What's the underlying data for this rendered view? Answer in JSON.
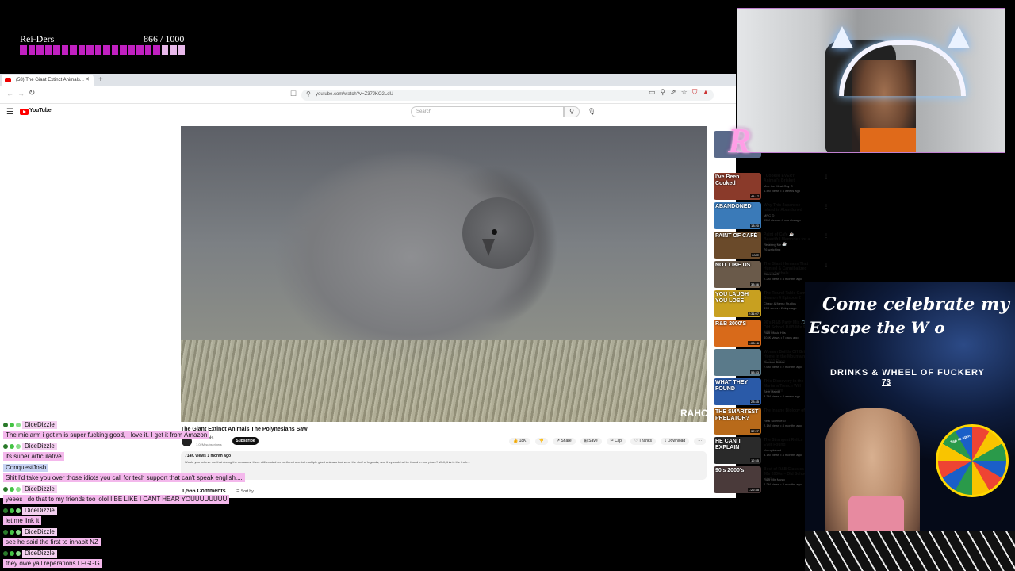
{
  "goal": {
    "title": "Rei-Ders",
    "count": "866 / 1000",
    "progress": 0.866,
    "color": "#c020c0",
    "light_color": "#e8b8ea"
  },
  "browser": {
    "tab_title": "(58) The Giant Extinct Animals...",
    "url": "youtube.com/watch?v=Z37JKO2LdU",
    "nav_back": "←",
    "nav_fwd": "→",
    "reload": "↻"
  },
  "youtube": {
    "logo": "YouTube",
    "search_placeholder": "Search",
    "video_watermark": "RAHO",
    "video_title": "The Giant Extinct Animals The Polynesians Saw",
    "channel_name": "Ctrlreels",
    "channel_subs": "1.02M subscribers",
    "subscribe_label": "Subscribe",
    "actions": [
      "👍 18K",
      "👎",
      "↗ Share",
      "⊞ Save",
      "✂ Clip",
      "♡ Thanks",
      "↓ Download",
      "⋯"
    ],
    "desc_stats": "714K views  1 month ago",
    "desc_text": "Would you believe me that during the crusades, there still existed on earth not one but multiple giant animals that were the stuff of legends, and they could all be found in one place? Well, this is the truth...",
    "comments_count": "1,566 Comments",
    "sort_label": "☰ Sort by"
  },
  "sidebar": [
    {
      "thumb_text": "",
      "duration": "",
      "title": "",
      "channel": "Clear Views",
      "meta": "3 days ago",
      "thumb_bg": "#5a6a8a"
    },
    {
      "thumb_text": "I've Been Cooked",
      "duration": "41:17",
      "title": "I Cooked EVERY Animal's Brisket",
      "channel": "Max the Meat Guy ⊙",
      "meta": "1.4M views • 3 weeks ago",
      "thumb_bg": "#8a3a2a"
    },
    {
      "thumb_text": "ABANDONED",
      "duration": "18:20",
      "title": "Why This Japanese Island is Abandoned",
      "channel": "MRC ⊙",
      "meta": "95M views • 4 months ago",
      "thumb_bg": "#3a7ab8"
    },
    {
      "thumb_text": "PAINT OF CAFÉ",
      "duration": "LIVE",
      "title": "Paint of Cafe ☕ Beautiful Memories for a quiet day ☕",
      "channel": "Relaxing Me",
      "meta": "76 watching",
      "thumb_bg": "#6a4a2a"
    },
    {
      "thumb_text": "NOT LIKE US",
      "duration": "33:36",
      "title": "The Giant Humans That Hunted & Cannibalized Neanderthals",
      "channel": "Ctrlreels ⊙",
      "meta": "2.2M views • 3 months ago",
      "thumb_bg": "#6a5a4a"
    },
    {
      "thumb_text": "YOU LAUGH YOU LOSE",
      "duration": "2:31:07",
      "title": "The Round Table Game Season 4 Episode 2",
      "channel": "Chase & Menu Studios",
      "meta": "39K views • 2 days ago",
      "thumb_bg": "#c8a020"
    },
    {
      "thumb_text": "R&B 2000'S",
      "duration": "1:03:16",
      "title": "90's R&B Party Mix 🎵 Old School R&B Mix 90s 2000s",
      "channel": "R&B Music Hits",
      "meta": "404K views • 7 days ago",
      "thumb_bg": "#d86a1a"
    },
    {
      "thumb_text": "",
      "duration": "53:33",
      "title": "Woman Builds Off Grid Home in the Mountains in 210 Days",
      "channel": "Outdoor Builds",
      "meta": "7.6M views • 2 months ago",
      "thumb_bg": "#5a7a8a"
    },
    {
      "thumb_text": "WHAT THEY FOUND",
      "duration": "28:45",
      "title": "This Discovery in the Mariana Trench Will Transform",
      "channel": "Sem Hamid",
      "meta": "3.3M views • 4 weeks ago",
      "thumb_bg": "#2a5aa8"
    },
    {
      "thumb_text": "THE SMARTEST PREDATOR?",
      "duration": "37:27",
      "title": "The Insane Biology of:",
      "channel": "Real Science ⊙",
      "meta": "2.1M views • 8 months ago",
      "thumb_bg": "#b86a1a"
    },
    {
      "thumb_text": "HE CAN'T EXPLAIN",
      "duration": "12:55",
      "title": "The Strangest Relics Ever Found",
      "channel": "Unexplained",
      "meta": "3.1M views • 4 months ago",
      "thumb_bg": "#2a2a2a"
    },
    {
      "thumb_text": "90's 2000's",
      "duration": "1:22:35",
      "title": "Best of R&B Classics 90s 2000s ~ Old School R&B",
      "channel": "R&B Mix Music",
      "meta": "2.2M views • 3 months ago",
      "thumb_bg": "#4a3a3a"
    }
  ],
  "webcam": {
    "logo_letter": "R"
  },
  "promo": {
    "line1": "Come celebrate my",
    "line2": "Escape the W o",
    "drinks": "DRINKS & WHEEL OF FUCKERY",
    "number": "73",
    "wheel_label": "Tap to spin"
  },
  "chat": [
    {
      "type": "user",
      "text": "DiceDizzle"
    },
    {
      "type": "msg",
      "text": "The mic arm i got rn is super fucking good, I love it. I get it from Amazon"
    },
    {
      "type": "user",
      "text": "DiceDizzle"
    },
    {
      "type": "msg",
      "text": "its super articulative"
    },
    {
      "type": "user",
      "text": "ConquestJosh"
    },
    {
      "type": "msg",
      "text": "Shit I'd take you over those idiots you call for tech support that can't speak english...."
    },
    {
      "type": "user",
      "text": "DiceDizzle"
    },
    {
      "type": "msg",
      "text": "yeees i do that to my friends too lolol I BE LIKE I CANT HEAR YOUUUUUUUU"
    },
    {
      "type": "user",
      "text": "DiceDizzle"
    },
    {
      "type": "msg",
      "text": "let me link it"
    },
    {
      "type": "user",
      "text": "DiceDizzle"
    },
    {
      "type": "msg",
      "text": "see he said the first to inhabit NZ"
    },
    {
      "type": "user",
      "text": "DiceDizzle"
    },
    {
      "type": "msg",
      "text": "they owe yall reperations LFGGG"
    }
  ]
}
